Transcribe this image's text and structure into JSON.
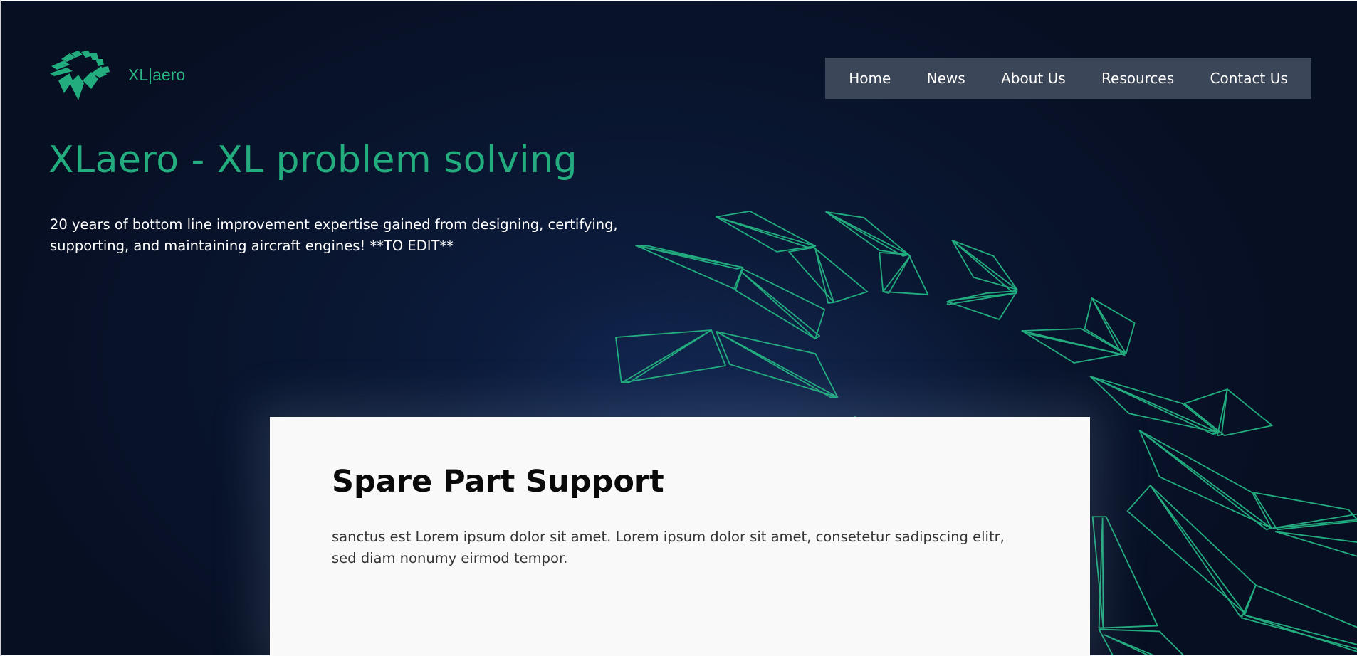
{
  "brand": {
    "logo_text": "XL|aero",
    "accent_color": "#23ad7f"
  },
  "nav": {
    "items": [
      {
        "label": "Home"
      },
      {
        "label": "News"
      },
      {
        "label": "About Us"
      },
      {
        "label": "Resources"
      },
      {
        "label": "Contact Us"
      }
    ],
    "background": "#3b4658"
  },
  "hero": {
    "title": "XLaero - XL problem solving",
    "description": "20 years of bottom line improvement expertise gained from designing, certifying, supporting, and maintaining aircraft engines! **TO EDIT**",
    "background": "#0a1736"
  },
  "card": {
    "title": "Spare Part Support",
    "body": "sanctus est Lorem ipsum dolor sit amet. Lorem ipsum dolor sit amet, consetetur sadipscing elitr, sed diam nonumy eirmod tempor."
  }
}
